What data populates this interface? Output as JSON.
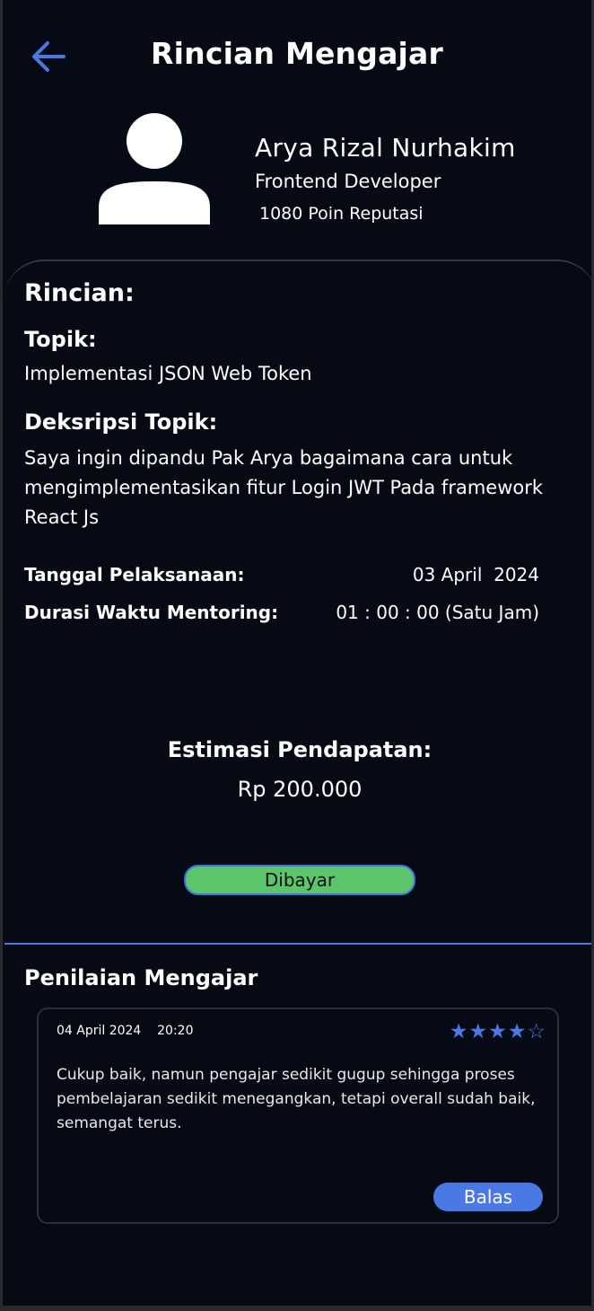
{
  "header": {
    "title": "Rincian Mengajar",
    "back_icon": "arrow-left-icon"
  },
  "profile": {
    "avatar_icon": "user-avatar-icon",
    "name": "Arya Rizal Nurhakim",
    "role": "Frontend Developer",
    "points": "1080 Poin Reputasi"
  },
  "details": {
    "heading": "Rincian:",
    "topic_label": "Topik:",
    "topic_value": "Implementasi JSON Web Token",
    "description_label": "Deksripsi Topik:",
    "description_value": "Saya ingin dipandu Pak Arya bagaimana cara untuk mengimplementasikan fitur Login JWT Pada framework React Js",
    "date_label": "Tanggal Pelaksanaan:",
    "date_value": "03 April  2024",
    "duration_label": "Durasi Waktu Mentoring:",
    "duration_value": "01 : 00 : 00 (Satu Jam)",
    "income_label": "Estimasi Pendapatan:",
    "income_value": "Rp 200.000",
    "status": "Dibayar"
  },
  "rating": {
    "heading": "Penilaian Mengajar",
    "review": {
      "date": "04 April 2024",
      "time": "20:20",
      "date_time": "04 April 2024    20:20",
      "stars": 4,
      "max_stars": 5,
      "stars_display": "★★★★☆",
      "text": "Cukup baik, namun pengajar sedikit gugup sehingga proses pembelajaran sedikit menegangkan, tetapi overall sudah baik, semangat terus.",
      "reply_label": "Balas"
    }
  },
  "colors": {
    "background": "#050a14",
    "accent": "#4a78e4",
    "status_paid": "#5cc46a",
    "text": "#ffffff"
  }
}
